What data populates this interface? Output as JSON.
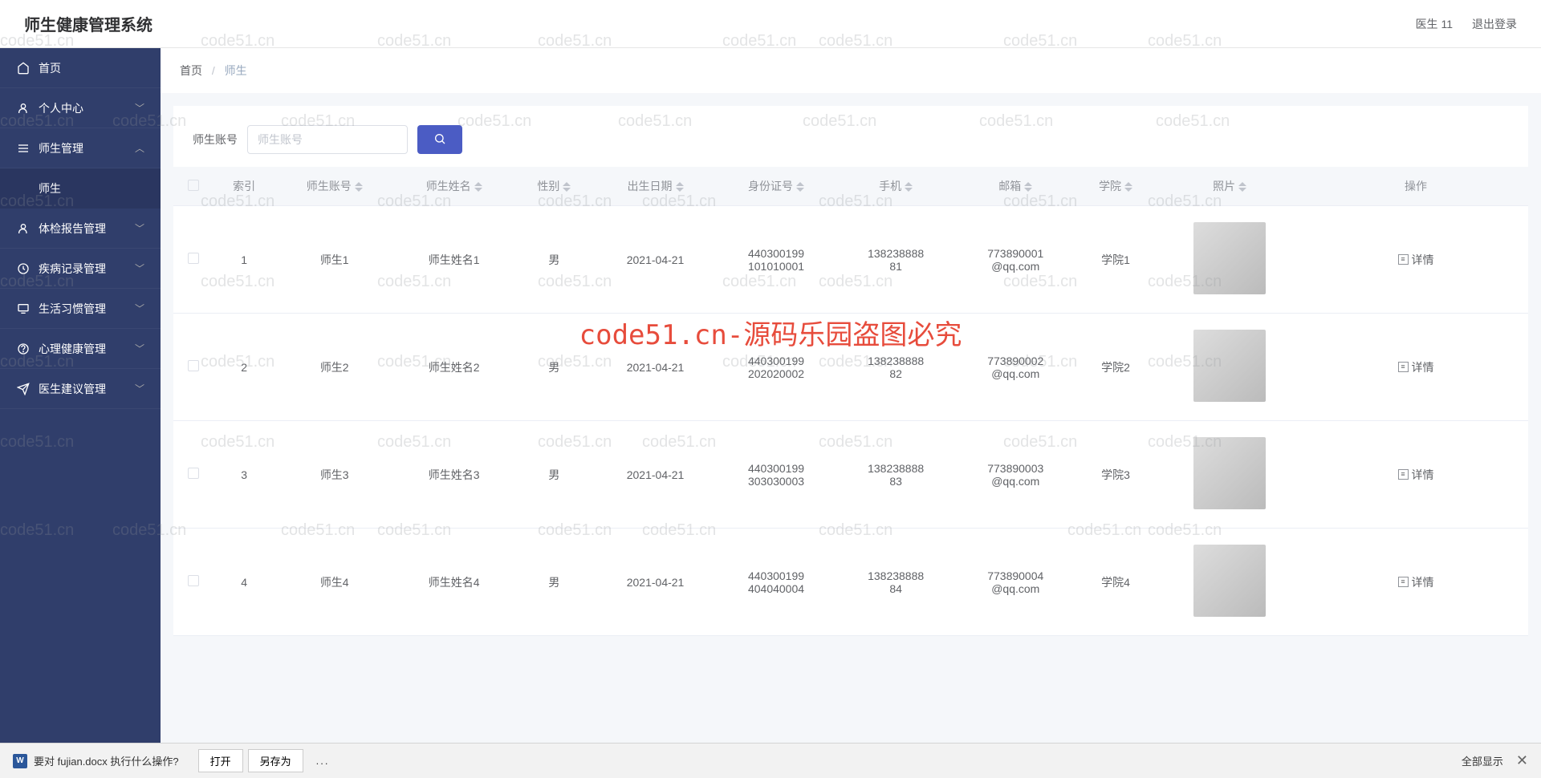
{
  "app_title": "师生健康管理系统",
  "header": {
    "user": "医生 11",
    "logout": "退出登录"
  },
  "sidebar": {
    "items": [
      {
        "icon": "home",
        "label": "首页"
      },
      {
        "icon": "user",
        "label": "个人中心",
        "arrow": "down"
      },
      {
        "icon": "menu",
        "label": "师生管理",
        "arrow": "up",
        "expanded": true,
        "children": [
          {
            "label": "师生",
            "active": true
          }
        ]
      },
      {
        "icon": "user",
        "label": "体检报告管理",
        "arrow": "down"
      },
      {
        "icon": "clock",
        "label": "疾病记录管理",
        "arrow": "down"
      },
      {
        "icon": "monitor",
        "label": "生活习惯管理",
        "arrow": "down"
      },
      {
        "icon": "help",
        "label": "心理健康管理",
        "arrow": "down"
      },
      {
        "icon": "send",
        "label": "医生建议管理",
        "arrow": "down"
      }
    ]
  },
  "breadcrumb": {
    "home": "首页",
    "sep": "/",
    "current": "师生"
  },
  "search": {
    "label": "师生账号",
    "placeholder": "师生账号"
  },
  "table": {
    "columns": [
      "索引",
      "师生账号",
      "师生姓名",
      "性别",
      "出生日期",
      "身份证号",
      "手机",
      "邮箱",
      "学院",
      "照片",
      "操作"
    ],
    "detail_label": "详情",
    "rows": [
      {
        "idx": "1",
        "account": "师生1",
        "name": "师生姓名1",
        "gender": "男",
        "dob": "2021-04-21",
        "idcard": "440300199101010001",
        "phone": "13823888881",
        "email": "773890001@qq.com",
        "college": "学院1"
      },
      {
        "idx": "2",
        "account": "师生2",
        "name": "师生姓名2",
        "gender": "男",
        "dob": "2021-04-21",
        "idcard": "440300199202020002",
        "phone": "13823888882",
        "email": "773890002@qq.com",
        "college": "学院2"
      },
      {
        "idx": "3",
        "account": "师生3",
        "name": "师生姓名3",
        "gender": "男",
        "dob": "2021-04-21",
        "idcard": "440300199303030003",
        "phone": "13823888883",
        "email": "773890003@qq.com",
        "college": "学院3"
      },
      {
        "idx": "4",
        "account": "师生4",
        "name": "师生姓名4",
        "gender": "男",
        "dob": "2021-04-21",
        "idcard": "440300199404040004",
        "phone": "13823888884",
        "email": "773890004@qq.com",
        "college": "学院4"
      }
    ]
  },
  "watermark_main": "code51.cn-源码乐园盗图必究",
  "watermark_small": "code51.cn",
  "download_bar": {
    "message": "要对 fujian.docx 执行什么操作?",
    "open": "打开",
    "save_as": "另存为",
    "more": "...",
    "show_all": "全部显示"
  }
}
